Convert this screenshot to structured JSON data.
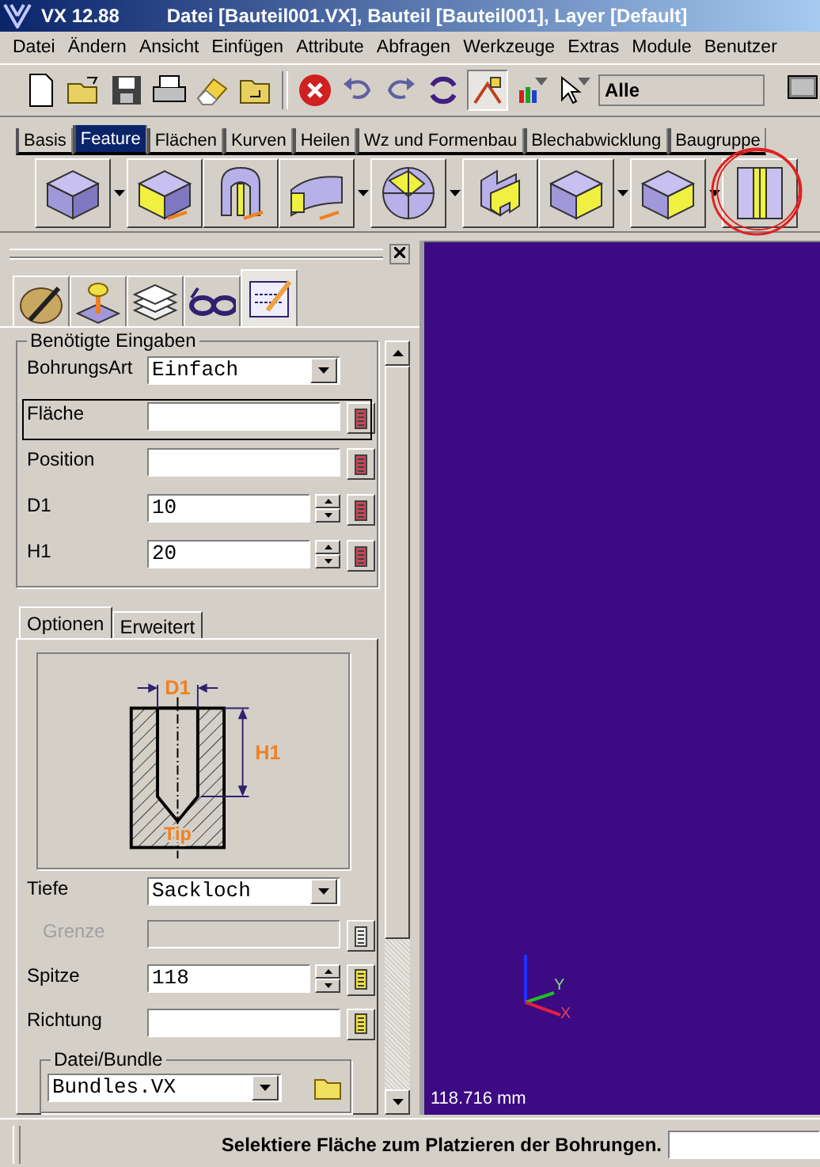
{
  "window": {
    "app": "VX 12.88",
    "title": "Datei [Bauteil001.VX], Bauteil [Bauteil001], Layer [Default]"
  },
  "menu": [
    "Datei",
    "Ändern",
    "Ansicht",
    "Einfügen",
    "Attribute",
    "Abfragen",
    "Werkzeuge",
    "Extras",
    "Module",
    "Benutzer"
  ],
  "toolbar": {
    "filter": "Alle"
  },
  "feature_tabs": [
    {
      "label": "Basis",
      "selected": false
    },
    {
      "label": "Feature",
      "selected": true
    },
    {
      "label": "Flächen",
      "selected": false
    },
    {
      "label": "Kurven",
      "selected": false
    },
    {
      "label": "Heilen",
      "selected": false
    },
    {
      "label": "Wz und Formenbau",
      "selected": false
    },
    {
      "label": "Blechabwicklung",
      "selected": false
    },
    {
      "label": "Baugruppe",
      "selected": false
    }
  ],
  "feature_tools": [
    {
      "kind": "block",
      "dropdown": true,
      "circled": false
    },
    {
      "kind": "extrude",
      "dropdown": false,
      "circled": false
    },
    {
      "kind": "revolve",
      "dropdown": false,
      "circled": false
    },
    {
      "kind": "sweep",
      "dropdown": true,
      "circled": false
    },
    {
      "kind": "sphere",
      "dropdown": true,
      "circled": false
    },
    {
      "kind": "profile",
      "dropdown": false,
      "circled": false
    },
    {
      "kind": "fillet",
      "dropdown": true,
      "circled": false
    },
    {
      "kind": "chamfer",
      "dropdown": true,
      "circled": false
    },
    {
      "kind": "hole",
      "dropdown": false,
      "circled": true
    }
  ],
  "panel_tabs": [
    {
      "kind": "palette",
      "selected": false
    },
    {
      "kind": "joystick",
      "selected": false
    },
    {
      "kind": "sheets",
      "selected": false
    },
    {
      "kind": "glasses",
      "selected": false
    },
    {
      "kind": "form",
      "selected": true
    }
  ],
  "required": {
    "title": "Benötigte Eingaben",
    "rows": [
      {
        "label": "BohrungsArt",
        "kind": "combo",
        "value": "Einfach",
        "focused": false
      },
      {
        "label": "Fläche",
        "kind": "field",
        "focused": true,
        "color": "#c84858"
      },
      {
        "label": "Position",
        "kind": "field",
        "focused": false,
        "color": "#c84858"
      },
      {
        "label": "D1",
        "kind": "spinner",
        "value": "10",
        "focused": false,
        "color": "#c84858"
      },
      {
        "label": "H1",
        "kind": "spinner",
        "value": "20",
        "focused": false,
        "color": "#c84858"
      }
    ]
  },
  "option_tabs": [
    {
      "label": "Optionen",
      "selected": true
    },
    {
      "label": "Erweitert",
      "selected": false
    }
  ],
  "diagram": {
    "d_label": "D1",
    "h_label": "H1",
    "tip_label": "Tip"
  },
  "options": [
    {
      "label": "Tiefe",
      "kind": "combo",
      "value": "Sackloch",
      "disabled": false
    },
    {
      "label": "Grenze",
      "kind": "field",
      "disabled": true,
      "color": "#ececec"
    },
    {
      "label": "Spitze",
      "kind": "spinner",
      "value": "118",
      "disabled": false,
      "color": "#f0e040"
    },
    {
      "label": "Richtung",
      "kind": "field",
      "disabled": false,
      "color": "#f0e040"
    }
  ],
  "bundle": {
    "title": "Datei/Bundle",
    "value": "Bundles.VX"
  },
  "viewport": {
    "x_label": "X",
    "y_label": "Y",
    "scale": "118.716 mm"
  },
  "status": {
    "message": "Selektiere Fläche zum Platzieren der Bohrungen."
  }
}
